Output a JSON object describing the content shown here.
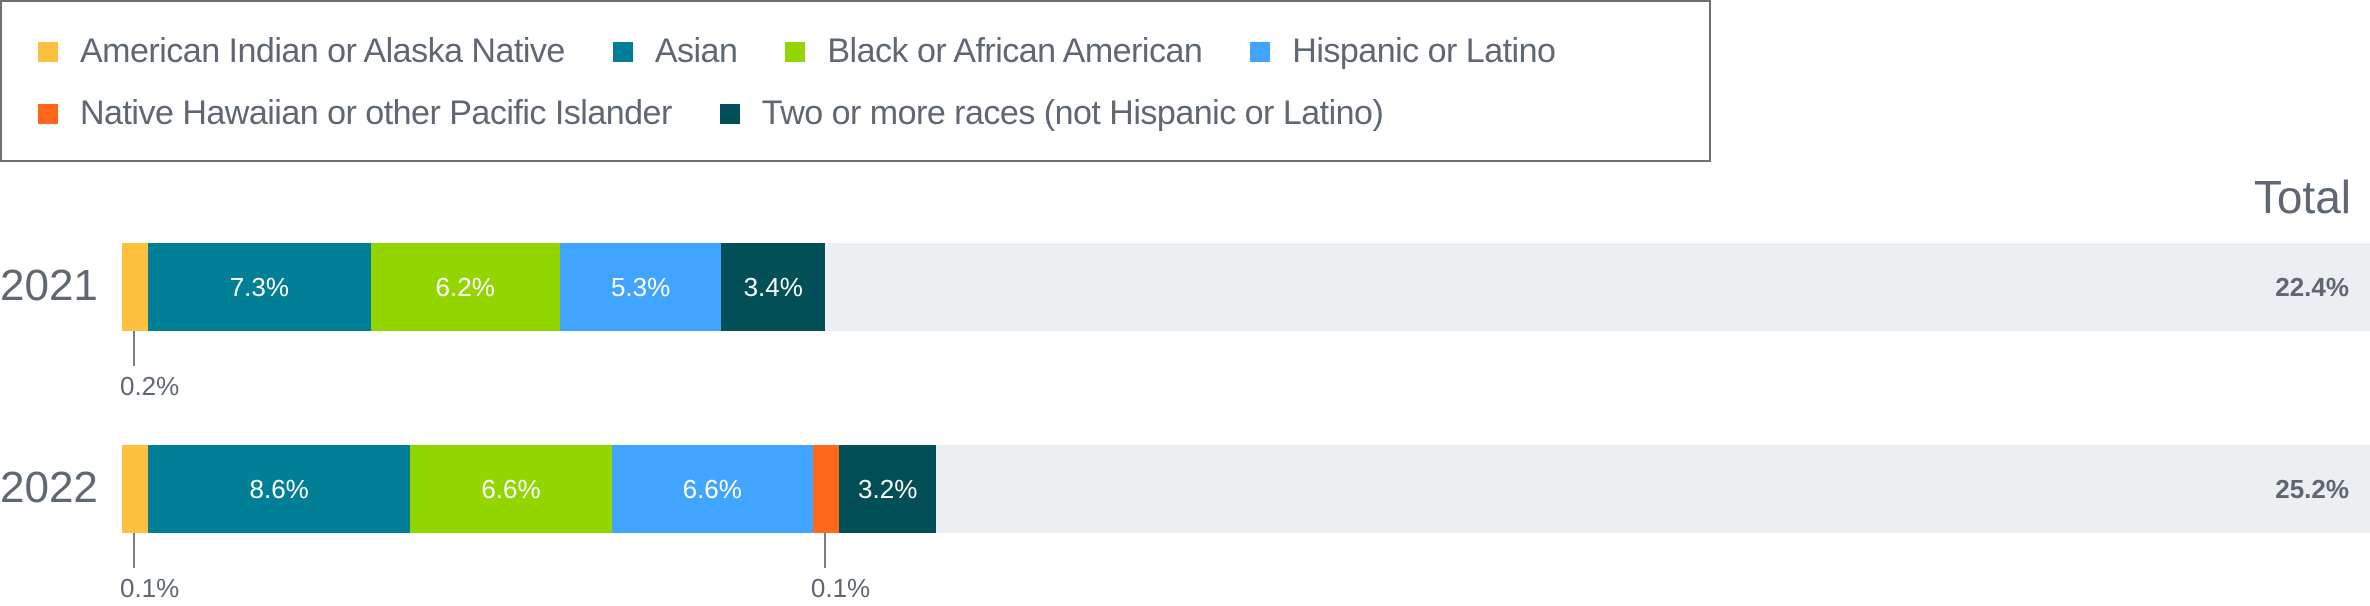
{
  "chart_data": {
    "type": "bar",
    "orientation": "horizontal",
    "stacked": true,
    "title": "",
    "xlabel": "",
    "ylabel": "",
    "legend_position": "top-left",
    "total_header": "Total",
    "categories": [
      "2021",
      "2022"
    ],
    "series": [
      {
        "name": "American Indian or Alaska Native",
        "color": "#ffbf3f",
        "values": [
          0.2,
          0.1
        ]
      },
      {
        "name": "Asian",
        "color": "#007f97",
        "values": [
          7.3,
          8.6
        ]
      },
      {
        "name": "Black or African American",
        "color": "#93d500",
        "values": [
          6.2,
          6.6
        ]
      },
      {
        "name": "Hispanic or Latino",
        "color": "#41a5ff",
        "values": [
          5.3,
          6.6
        ]
      },
      {
        "name": "Native Hawaiian or other Pacific Islander",
        "color": "#ff671d",
        "values": [
          0.0,
          0.1
        ]
      },
      {
        "name": "Two or more races (not Hispanic or Latino)",
        "color": "#034f57",
        "values": [
          3.4,
          3.2
        ]
      }
    ],
    "segment_labels": [
      [
        "0.2%",
        "7.3%",
        "6.2%",
        "5.3%",
        "",
        "3.4%"
      ],
      [
        "0.1%",
        "8.6%",
        "6.6%",
        "6.6%",
        "0.1%",
        "3.2%"
      ]
    ],
    "totals": [
      22.4,
      25.2
    ],
    "total_labels": [
      "22.4%",
      "25.2%"
    ],
    "track_color": "#ebeff2",
    "xlim": [
      0,
      100
    ]
  }
}
